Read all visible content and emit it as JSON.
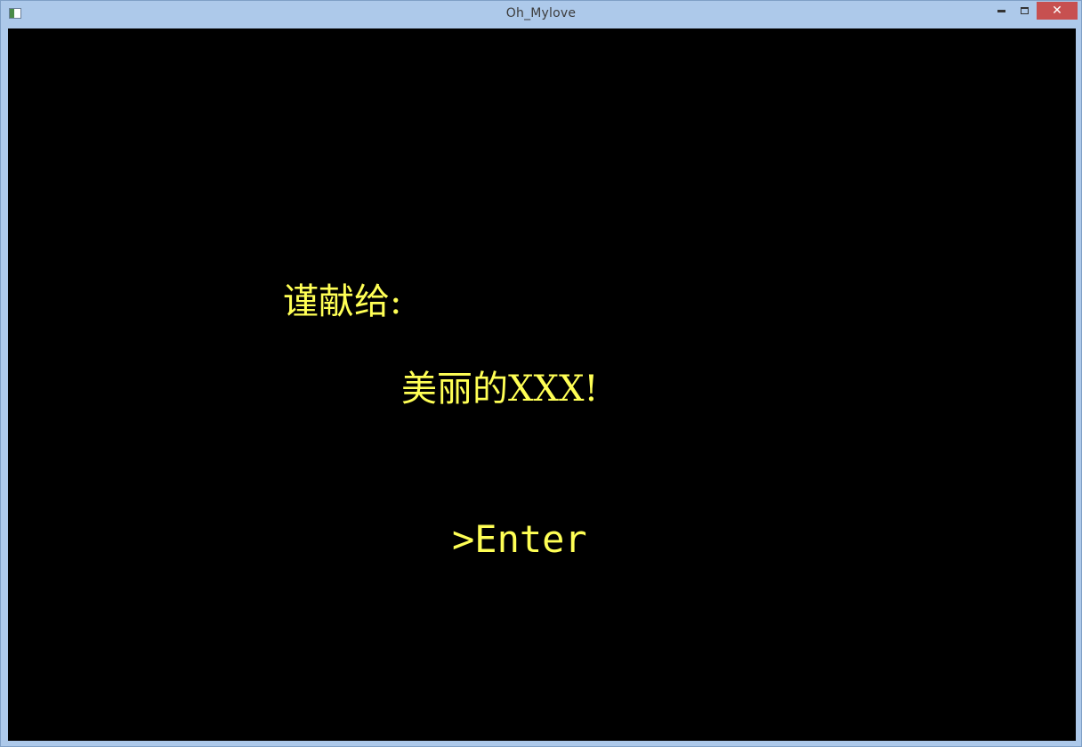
{
  "window": {
    "title": "Oh_Mylove",
    "controls": {
      "minimize": "minimize",
      "maximize": "maximize",
      "close": "✕"
    }
  },
  "screen": {
    "dedication_label": "谨献给:",
    "recipient": "美丽的XXX!",
    "enter_prompt": ">Enter"
  },
  "colors": {
    "text": "#ffff55",
    "background": "#000000",
    "frame": "#adc9ea",
    "close_button": "#c75050"
  }
}
